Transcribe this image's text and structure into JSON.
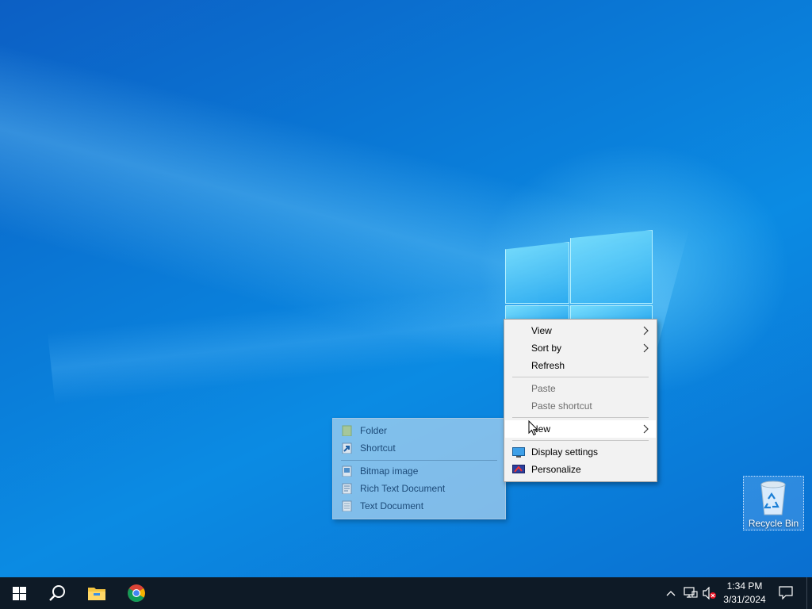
{
  "desktop": {
    "icons": [
      {
        "label": "Recycle Bin",
        "icon": "recycle-bin-icon"
      }
    ]
  },
  "context_menu": {
    "items": [
      {
        "label": "View",
        "has_submenu": true,
        "enabled": true
      },
      {
        "label": "Sort by",
        "has_submenu": true,
        "enabled": true
      },
      {
        "label": "Refresh",
        "has_submenu": false,
        "enabled": true
      },
      {
        "label": "Paste",
        "has_submenu": false,
        "enabled": false
      },
      {
        "label": "Paste shortcut",
        "has_submenu": false,
        "enabled": false
      },
      {
        "label": "New",
        "has_submenu": true,
        "enabled": true,
        "highlighted": true
      },
      {
        "label": "Display settings",
        "icon": "display-icon",
        "enabled": true
      },
      {
        "label": "Personalize",
        "icon": "personalize-icon",
        "enabled": true
      }
    ]
  },
  "new_submenu": {
    "items": [
      {
        "label": "Folder",
        "icon": "folder-icon"
      },
      {
        "label": "Shortcut",
        "icon": "shortcut-icon"
      },
      {
        "label": "Bitmap image",
        "icon": "bitmap-icon"
      },
      {
        "label": "Rich Text Document",
        "icon": "rich-text-icon"
      },
      {
        "label": "Text Document",
        "icon": "text-document-icon"
      }
    ]
  },
  "taskbar": {
    "pinned": [
      {
        "name": "start",
        "icon": "windows-start-icon"
      },
      {
        "name": "search",
        "icon": "search-icon"
      },
      {
        "name": "file-explorer",
        "icon": "file-explorer-icon"
      },
      {
        "name": "chrome",
        "icon": "chrome-icon"
      }
    ],
    "tray": {
      "time": "1:34 PM",
      "date": "3/31/2024",
      "icons": [
        "chevron-up-icon",
        "network-icon",
        "volume-muted-icon",
        "notification-icon"
      ]
    }
  },
  "colors": {
    "desktop_accent": "#0a79d6",
    "taskbar": "#0e1a26",
    "menu_bg": "#f2f2f2"
  }
}
